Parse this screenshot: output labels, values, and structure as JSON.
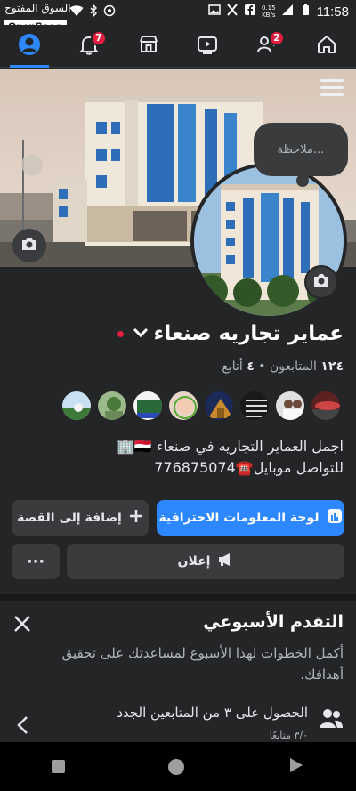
{
  "status_bar": {
    "watermark": "السوق المفتوح",
    "brand": "OpenSooq",
    "time": "11:58",
    "speed_value": "0.15",
    "speed_unit": "KB/s"
  },
  "nav": {
    "notifications_badge": "7",
    "friends_badge": "2"
  },
  "cover": {
    "note_placeholder": "ملاحظة..."
  },
  "profile": {
    "name": "عماير تجاريه صنعاء",
    "followers_count": "١٢٤",
    "followers_label": "المتابعون",
    "following_count": "٤",
    "following_label": "أتابع",
    "separator": "•",
    "bio_line1": "اجمل العماير التجاريه في صنعاء 🇾🇪🏢",
    "bio_line2": "للتواصل موبايل☎️776875074"
  },
  "actions": {
    "dashboard_label": "لوحة المعلومات الاحترافية",
    "add_story_label": "إضافة إلى القصة",
    "advertise_label": "إعلان",
    "more_label": "···"
  },
  "weekly_progress": {
    "title": "التقدم الأسبوعي",
    "description": "أكمل الخطوات لهذا الأسبوع لمساعدتك على تحقيق أهدافك.",
    "goal_title": "الحصول على ٣ من المتابعين الجدد",
    "goal_progress": "٣/٠ متابعًا"
  },
  "colors": {
    "accent": "#2d88ff",
    "background": "#242526",
    "badge": "#e41e3f"
  }
}
